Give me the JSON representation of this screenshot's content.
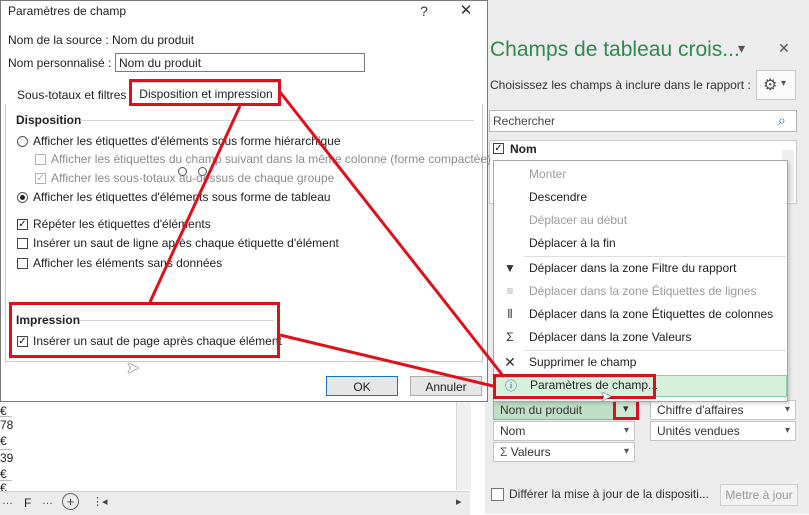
{
  "dialog": {
    "title": "Paramètres de champ",
    "help_icon": "?",
    "close_icon": "✕",
    "source_label": "Nom de la source :",
    "source_value": "Nom du produit",
    "custom_name_label": "Nom personnalisé :",
    "custom_name_value": "Nom du produit",
    "tabs": [
      "Sous-totaux et filtres",
      "Disposition et impression"
    ],
    "layout_title": "Disposition",
    "opt_outline": "Afficher les étiquettes d'éléments sous forme hiérarchique",
    "opt_compact": "Afficher les étiquettes du champ suivant dans la même colonne (forme compactée)",
    "opt_subtotals_top": "Afficher les sous-totaux au-dessus de chaque groupe",
    "opt_tabular": "Afficher les étiquettes d'éléments sous forme de tableau",
    "opt_repeat": "Répéter les étiquettes d'éléments",
    "opt_blank_line": "Insérer un saut de ligne après chaque étiquette d'élément",
    "opt_no_data": "Afficher les éléments sans données",
    "print_title": "Impression",
    "opt_page_break": "Insérer un saut de page après chaque élément",
    "ok": "OK",
    "cancel": "Annuler"
  },
  "pane": {
    "title": "Champs de tableau crois...",
    "dropdown_icon": "▾",
    "close_icon": "✕",
    "choose": "Choisissez les champs à inclure dans le rapport :",
    "gear_icon": "⚙",
    "search_placeholder": "Rechercher",
    "search_icon": "⌕",
    "field_first": "Nom",
    "defer_label": "Différer la mise à jour de la dispositi...",
    "update_button": "Mettre à jour"
  },
  "menu": {
    "items": [
      "Monter",
      "Descendre",
      "Déplacer au début",
      "Déplacer à la fin",
      "Déplacer dans la zone Filtre du rapport",
      "Déplacer dans la zone Étiquettes de lignes",
      "Déplacer dans la zone Étiquettes de colonnes",
      "Déplacer dans la zone Valeurs",
      "Supprimer le champ",
      "Paramètres de champ..."
    ]
  },
  "zones": {
    "rows": [
      "Nom du produit",
      "Nom",
      "Valeurs"
    ],
    "values": [
      "Chiffre d'affaires",
      "Unités vendues"
    ],
    "sigma": "Σ"
  },
  "sheet": {
    "cells": [
      "€",
      "78",
      "€",
      "39",
      "€",
      "€"
    ],
    "tab_label": "F"
  },
  "colors": {
    "accent_green": "#2f8a4f",
    "highlight_red": "#e0101a",
    "selected_menu": "#d7f0dd"
  }
}
